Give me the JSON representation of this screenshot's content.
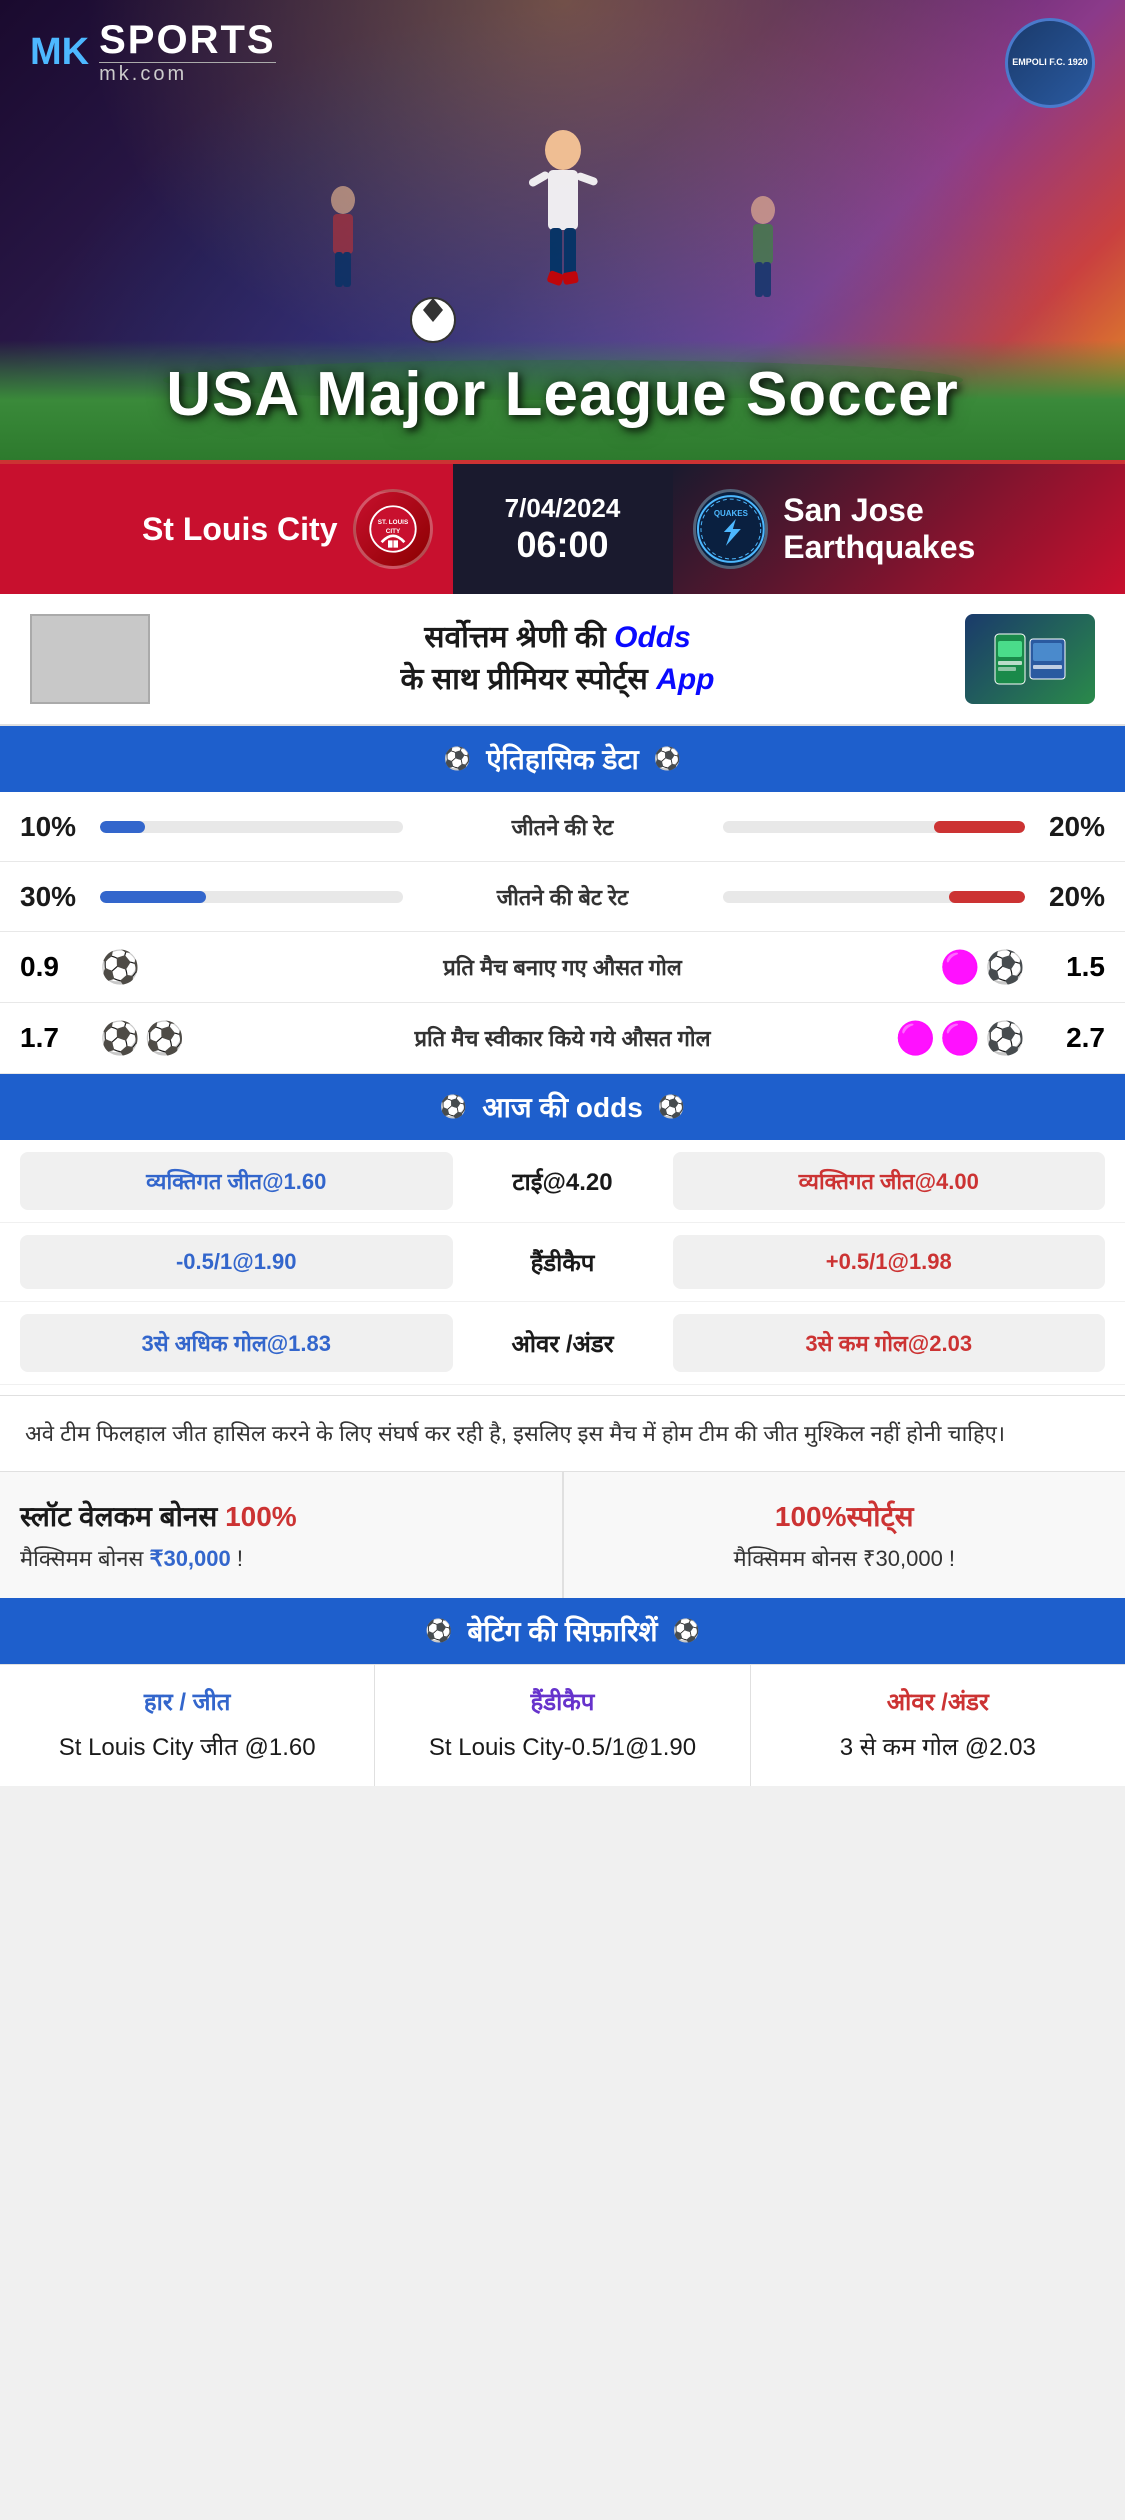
{
  "brand": {
    "logo_mk": "MK",
    "logo_sports": "SPORTS",
    "logo_url": "mk.com",
    "empoli_text": "EMPOLI F.C.\n1920"
  },
  "hero": {
    "title": "USA Major League Soccer"
  },
  "match": {
    "date": "7/04/2024",
    "time": "06:00",
    "home_team": "St Louis City",
    "away_team": "San Jose Earthquakes",
    "away_team_abbr": "QUAKES"
  },
  "promo": {
    "text_line1": "सर्वोत्तम श्रेणी की",
    "text_highlight": "Odds",
    "text_line2": "के साथ प्रीमियर स्पोर्ट्स",
    "text_app": "App"
  },
  "historical_section": {
    "title": "ऐतिहासिक डेटा",
    "stats": [
      {
        "label": "जीतने की रेट",
        "left_val": "10%",
        "right_val": "20%",
        "left_pct": 15,
        "right_pct": 30
      },
      {
        "label": "जीतने की बेट रेट",
        "left_val": "30%",
        "right_val": "20%",
        "left_pct": 35,
        "right_pct": 25
      }
    ],
    "goal_stats": [
      {
        "label": "प्रति मैच बनाए गए औसत गोल",
        "left_val": "0.9",
        "right_val": "1.5",
        "left_balls": 1,
        "right_balls": 2
      },
      {
        "label": "प्रति मैच स्वीकार किये गये औसत गोल",
        "left_val": "1.7",
        "right_val": "2.7",
        "left_balls": 2,
        "right_balls": 3
      }
    ]
  },
  "odds_section": {
    "title": "आज की odds",
    "rows": [
      {
        "left": "व्यक्तिगत जीत@1.60",
        "center": "टाई@4.20",
        "right": "व्यक्तिगत जीत@4.00"
      },
      {
        "left": "-0.5/1@1.90",
        "center": "हैंडीकैप",
        "right": "+0.5/1@1.98"
      },
      {
        "left": "3से अधिक गोल@1.83",
        "center": "ओवर /अंडर",
        "right": "3से कम गोल@2.03"
      }
    ]
  },
  "description": "अवे टीम फिलहाल जीत हासिल करने के लिए संघर्ष कर रही है, इसलिए इस मैच में होम टीम की जीत मुश्किल नहीं होनी चाहिए।",
  "bonus": {
    "left_title": "स्लॉट वेलकम बोनस 100%",
    "left_subtitle": "मैक्सिमम बोनस ₹30,000  !",
    "right_title": "100%स्पोर्ट्स",
    "right_subtitle": "मैक्सिमम बोनस  ₹30,000 !"
  },
  "betting_rec": {
    "title": "बेटिंग की सिफ़ारिशें",
    "cols": [
      {
        "title": "हार / जीत",
        "color": "blue",
        "value": "St Louis City जीत @1.60"
      },
      {
        "title": "हैंडीकैप",
        "color": "purple",
        "value": "St Louis City-0.5/1@1.90"
      },
      {
        "title": "ओवर /अंडर",
        "color": "red",
        "value": "3 से कम गोल @2.03"
      }
    ]
  }
}
